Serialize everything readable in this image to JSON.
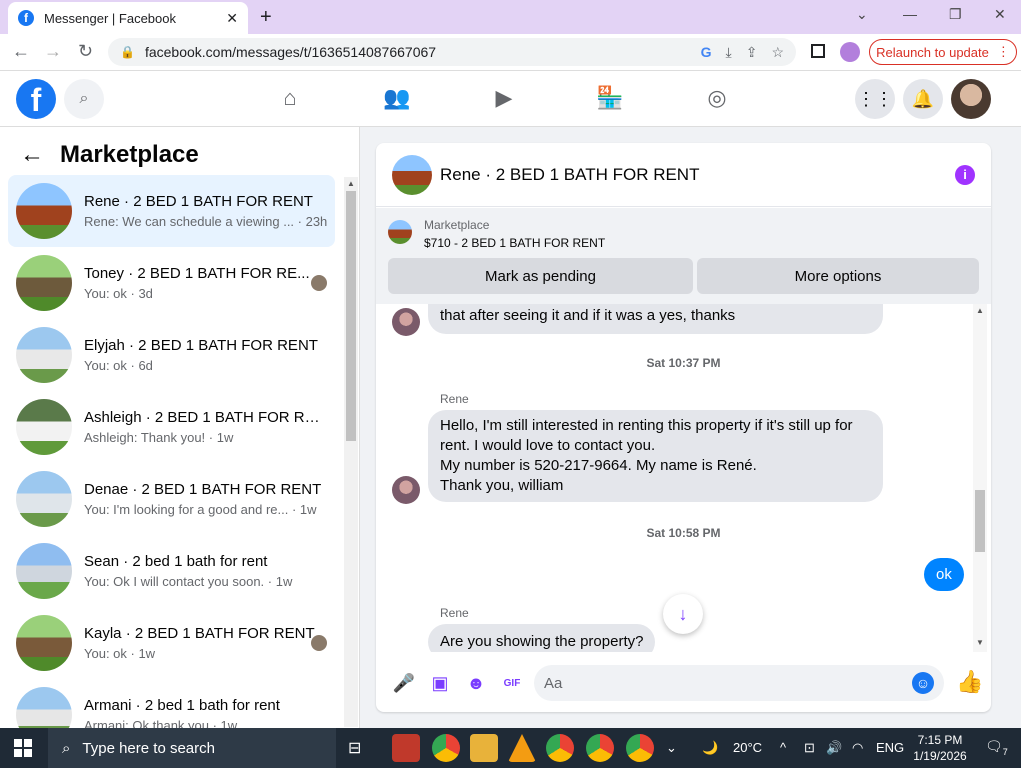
{
  "browser": {
    "tab_title": "Messenger | Facebook",
    "url": "facebook.com/messages/t/1636514087667067",
    "relaunch_label": "Relaunch to update"
  },
  "marketplace": {
    "title": "Marketplace",
    "chats": [
      {
        "name": "Rene · 2 BED 1 BATH FOR RENT",
        "preview": "Rene: We can schedule a viewing ... · 23h"
      },
      {
        "name": "Toney · 2 BED 1 BATH FOR RE...",
        "preview": "You: ok · 3d"
      },
      {
        "name": "Elyjah · 2 BED 1 BATH FOR RENT",
        "preview": "You: ok · 6d"
      },
      {
        "name": "Ashleigh · 2 BED 1 BATH FOR RE...",
        "preview": "Ashleigh: Thank you! · 1w"
      },
      {
        "name": "Denae · 2 BED 1 BATH FOR RENT",
        "preview": "You: I'm looking for a good and re... · 1w"
      },
      {
        "name": "Sean · 2 bed 1 bath for rent",
        "preview": "You: Ok I will contact you soon. · 1w"
      },
      {
        "name": "Kayla · 2 BED 1 BATH FOR RENT",
        "preview": "You: ok · 1w"
      },
      {
        "name": "Armani · 2 bed 1 bath for rent",
        "preview": "Armani: Ok thank you · 1w"
      }
    ]
  },
  "conversation": {
    "title": "Rene · 2 BED 1 BATH FOR RENT",
    "listing_label": "Marketplace",
    "listing_price": "$710 - 2 BED 1 BATH FOR RENT",
    "mark_pending": "Mark as pending",
    "more_options": "More options",
    "messages": {
      "m1": "that after seeing it and if it was a yes, thanks",
      "ts1": "Sat 10:37 PM",
      "sender2": "Rene",
      "m2_l1": "Hello, I'm still interested in renting this property if it's still up for",
      "m2_l2": "rent. I would love to contact you.",
      "m2_l3": "My number is 520-217-9664. My name is René.",
      "m2_l4": "Thank you, william",
      "ts2": "Sat 10:58 PM",
      "mine": "ok",
      "sender3": "Rene",
      "m3": "Are you showing the property?"
    },
    "composer_placeholder": "Aa"
  },
  "taskbar": {
    "search_placeholder": "Type here to search",
    "weather": "20°C",
    "lang": "ENG",
    "time": "7:15 PM",
    "date": "1/19/2026",
    "notif_count": "7"
  }
}
